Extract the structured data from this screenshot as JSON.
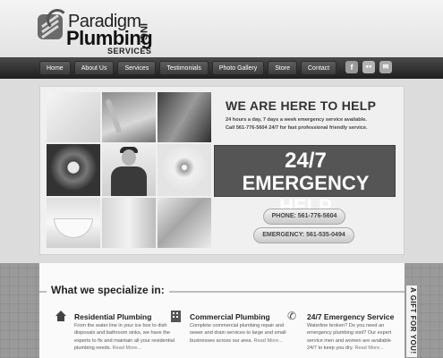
{
  "brand": {
    "name_top": "Paradigm",
    "name_main": "Plumbing",
    "suffix": "INC.",
    "tagline": "SERVICES"
  },
  "nav": {
    "items": [
      "Home",
      "About Us",
      "Services",
      "Testimonials",
      "Photo Gallery",
      "Store",
      "Contact"
    ]
  },
  "social": {
    "icons": [
      {
        "name": "facebook-icon",
        "glyph": "f"
      },
      {
        "name": "flickr-icon",
        "glyph": "●●"
      },
      {
        "name": "chat-icon",
        "glyph": "✉"
      }
    ]
  },
  "hero": {
    "title": "WE ARE HERE TO HELP",
    "subtitle_line1": "24 hours a day, 7 days a week emergency service available.",
    "subtitle_line2": "Call 561-776-5604 24/7 for fast professional friendly service.",
    "emergency_line1": "24/7",
    "emergency_line2": "EMERGENCY HELP",
    "phone_label": "PHONE: 561-776-5604",
    "emergency_phone_label": "EMERGENCY: 561-535-0494"
  },
  "services": {
    "heading": "What we specialize in:",
    "items": [
      {
        "icon": "house-icon",
        "title": "Residential Plumbing",
        "description": "From the water line in your ice box to dish disposals and bathroom sinks, we have the experts to fix and maintain all your residential plumbing needs.",
        "more": "Read More..."
      },
      {
        "icon": "building-icon",
        "title": "Commercial Plumbing",
        "description": "Complete commercial plumbing repair and sewer and drain services to large and small businesses across our area.",
        "more": "Read More..."
      },
      {
        "icon": "phone-icon",
        "title": "24/7 Emergency Service",
        "description": "Waterline broken? Do you need an emergency plumbing visit? Our expert service men and women are available 24/7 to keep you dry.",
        "more": "Read More..."
      }
    ]
  },
  "gift_tab": {
    "label": "A GIFT FOR YOU!"
  }
}
